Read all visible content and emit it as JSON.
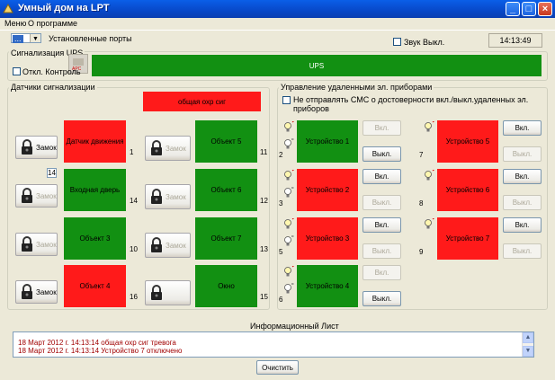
{
  "window": {
    "title": "Умный дом на LPT"
  },
  "menu": {
    "items": [
      "Меню",
      "О программе"
    ]
  },
  "top": {
    "port_value": "...",
    "ports_label": "Установленные порты",
    "sound_label": "Звук Выкл.",
    "time": "14:13:49"
  },
  "ups": {
    "group_title": "Сигнализация UPS",
    "control_label": "Откл. Контроль",
    "bar_label": "UPS",
    "bar_color": "#129012",
    "device_label": "APC"
  },
  "sensors": {
    "group_title": "Датчики сигнализации",
    "header_alarm": "общая охр сиг",
    "badge_value": "14",
    "lock_label": "Замок",
    "left": [
      {
        "lock_label": "Замок",
        "lock_enabled": true,
        "name": "Датчик движения",
        "state": "red",
        "num": "1"
      },
      {
        "lock_label": "Замок",
        "lock_enabled": false,
        "name": "Входная дверь",
        "state": "green",
        "num": "14"
      },
      {
        "lock_label": "Замок",
        "lock_enabled": false,
        "name": "Объект 3",
        "state": "green",
        "num": "10"
      },
      {
        "lock_label": "Замок",
        "lock_enabled": true,
        "name": "Объект 4",
        "state": "red",
        "num": "16"
      }
    ],
    "right": [
      {
        "lock_label": "Замок",
        "lock_enabled": false,
        "name": "Объект 5",
        "state": "green",
        "num": "11"
      },
      {
        "lock_label": "Замок",
        "lock_enabled": false,
        "name": "Объект 6",
        "state": "green",
        "num": "12"
      },
      {
        "lock_label": "Замок",
        "lock_enabled": false,
        "name": "Объект 7",
        "state": "green",
        "num": "13"
      },
      {
        "lock_label": "",
        "lock_enabled": false,
        "name": "Окно",
        "state": "green",
        "num": "15"
      }
    ]
  },
  "devices": {
    "group_title": "Управление удаленными эл. приборами",
    "sms_label": "Не отправлять СМС о достоверности вкл./выкл.удаленных эл. приборов",
    "on_label": "Вкл.",
    "off_label": "Выкл.",
    "left": [
      {
        "name": "Устройство 1",
        "state": "green",
        "num": "2",
        "on_enabled": false,
        "off_enabled": true
      },
      {
        "name": "Устройство 2",
        "state": "red",
        "num": "3",
        "on_enabled": true,
        "off_enabled": false
      },
      {
        "name": "Устройство 3",
        "state": "red",
        "num": "5",
        "on_enabled": true,
        "off_enabled": false
      },
      {
        "name": "Устройство 4",
        "state": "green",
        "num": "6",
        "on_enabled": false,
        "off_enabled": true
      }
    ],
    "right": [
      {
        "name": "Устройство 5",
        "state": "red",
        "num": "7",
        "on_enabled": true,
        "off_enabled": false
      },
      {
        "name": "Устройство 6",
        "state": "red",
        "num": "8",
        "on_enabled": true,
        "off_enabled": false
      },
      {
        "name": "Устройство 7",
        "state": "red",
        "num": "9",
        "on_enabled": true,
        "off_enabled": false
      }
    ]
  },
  "info": {
    "title": "Информационный Лист",
    "lines": [
      "18 Март 2012 г. 14:13:14   общая охр сиг  тревога",
      "18 Март 2012 г. 14:13:14   Устройство 7  отключено"
    ],
    "clear_label": "Очистить"
  },
  "colors": {
    "green": "#129012",
    "red": "#FF1A1A",
    "title_blue": "#0848C8"
  }
}
